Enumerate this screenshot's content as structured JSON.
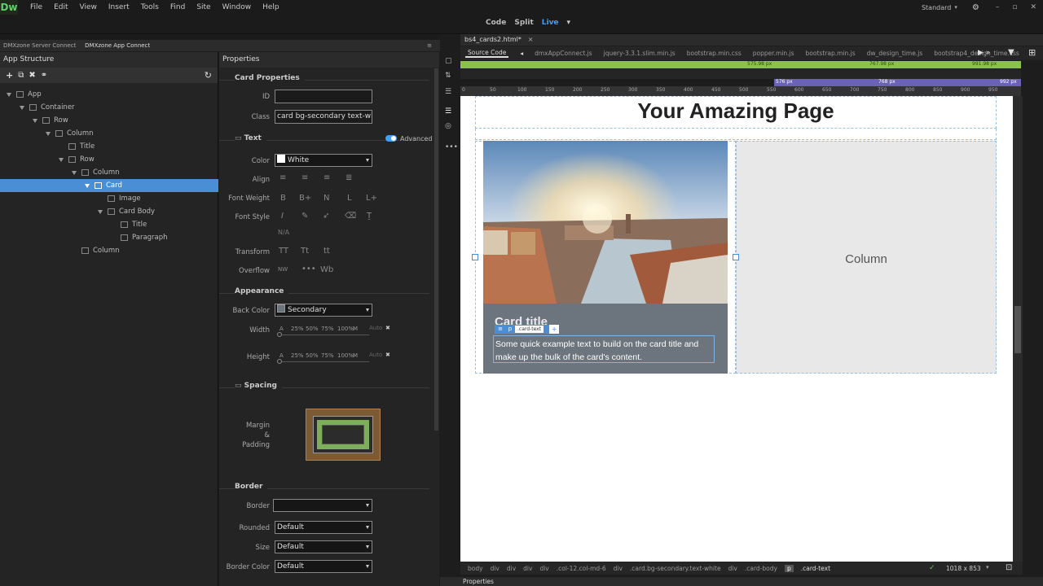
{
  "app": {
    "logo": "Dw"
  },
  "menubar": {
    "items": [
      "File",
      "Edit",
      "View",
      "Insert",
      "Tools",
      "Find",
      "Site",
      "Window",
      "Help"
    ],
    "workspace": "Standard"
  },
  "modebar": {
    "code": "Code",
    "split": "Split",
    "live": "Live"
  },
  "panel_tabs": [
    "DMXzone Server Connect",
    "DMXzone App Connect"
  ],
  "app_structure": {
    "title": "App Structure",
    "tree": [
      {
        "label": "App",
        "level": 0,
        "icon": "app-icon"
      },
      {
        "label": "Container",
        "level": 1,
        "icon": "container-icon"
      },
      {
        "label": "Row",
        "level": 2,
        "icon": "row-icon"
      },
      {
        "label": "Column",
        "level": 3,
        "icon": "column-icon"
      },
      {
        "label": "Title",
        "level": 4,
        "icon": "title-icon"
      },
      {
        "label": "Row",
        "level": 4,
        "icon": "row-icon"
      },
      {
        "label": "Column",
        "level": 5,
        "icon": "column-icon"
      },
      {
        "label": "Card",
        "level": 6,
        "icon": "card-icon",
        "selected": true
      },
      {
        "label": "Image",
        "level": 7,
        "icon": "image-icon"
      },
      {
        "label": "Card Body",
        "level": 7,
        "icon": "card-body-icon"
      },
      {
        "label": "Title",
        "level": 8,
        "icon": "title-icon"
      },
      {
        "label": "Paragraph",
        "level": 8,
        "icon": "paragraph-icon"
      },
      {
        "label": "Column",
        "level": 5,
        "icon": "column-icon"
      }
    ]
  },
  "properties": {
    "title": "Properties",
    "card_properties": {
      "heading": "Card Properties",
      "id_label": "ID",
      "id_value": "",
      "class_label": "Class",
      "class_value": "card bg-secondary text-wh"
    },
    "text": {
      "heading": "Text",
      "advanced_label": "Advanced",
      "color_label": "Color",
      "color_value": "White",
      "align_label": "Align",
      "font_weight_label": "Font Weight",
      "font_weight_opts": [
        "B",
        "B+",
        "N",
        "L",
        "L+"
      ],
      "font_style_label": "Font Style",
      "font_style_na": "N/A",
      "transform_label": "Transform",
      "transform_opts": [
        "TT",
        "Tt",
        "tt"
      ],
      "overflow_label": "Overflow",
      "overflow_opts": [
        "NW",
        "Wb"
      ]
    },
    "appearance": {
      "heading": "Appearance",
      "back_color_label": "Back Color",
      "back_color_value": "Secondary",
      "width_label": "Width",
      "height_label": "Height",
      "size_opts": [
        "A",
        "25%",
        "50%",
        "75%",
        "100%",
        "M"
      ],
      "auto_label": "Auto"
    },
    "spacing": {
      "heading": "Spacing",
      "margin_label": "Margin",
      "amp": "&",
      "padding_label": "Padding"
    },
    "border": {
      "heading": "Border",
      "border_label": "Border",
      "border_value": "",
      "rounded_label": "Rounded",
      "rounded_value": "Default",
      "size_label": "Size",
      "size_value": "Default",
      "border_color_label": "Border Color",
      "border_color_value": "Default"
    }
  },
  "document": {
    "tab": "bs4_cards2.html*",
    "source_code": "Source Code",
    "files": [
      "dmxAppConnect.js",
      "jquery-3.3.1.slim.min.js",
      "bootstrap.min.css",
      "popper.min.js",
      "bootstrap.min.js",
      "dw_design_time.js",
      "bootstrap4_design_time.css"
    ],
    "breakpoints_green": [
      "575.98 px",
      "767.98 px",
      "991.98 px"
    ],
    "breakpoints_purple": [
      "576 px",
      "768 px",
      "992 px"
    ],
    "ruler_ticks": [
      "0",
      "50",
      "100",
      "150",
      "200",
      "250",
      "300",
      "350",
      "400",
      "450",
      "500",
      "550",
      "600",
      "650",
      "700",
      "750",
      "800",
      "850",
      "900",
      "950"
    ],
    "page_heading": "Your Amazing Page",
    "card_title": "Card title",
    "card_text": "Some quick example text to build on the card title and make up the bulk of the card's content.",
    "inline_tag": "p",
    "inline_class": ".card-text",
    "column_label": "Column",
    "tag_path": [
      "body",
      "div",
      "div",
      "div",
      "div",
      ".col-12.col-md-6",
      "div",
      ".card.bg-secondary.text-white",
      "div",
      ".card-body",
      "p",
      ".card-text"
    ],
    "viewport_size": "1018 x 853"
  },
  "bottom_panel": "Properties",
  "colors": {
    "accent": "#4a8fd6",
    "live": "#3ea0ff",
    "green_bar": "#8bc34a",
    "purple_bar": "#6a62b5",
    "card_bg": "#6c757d",
    "column_bg": "#e8e8e8"
  }
}
